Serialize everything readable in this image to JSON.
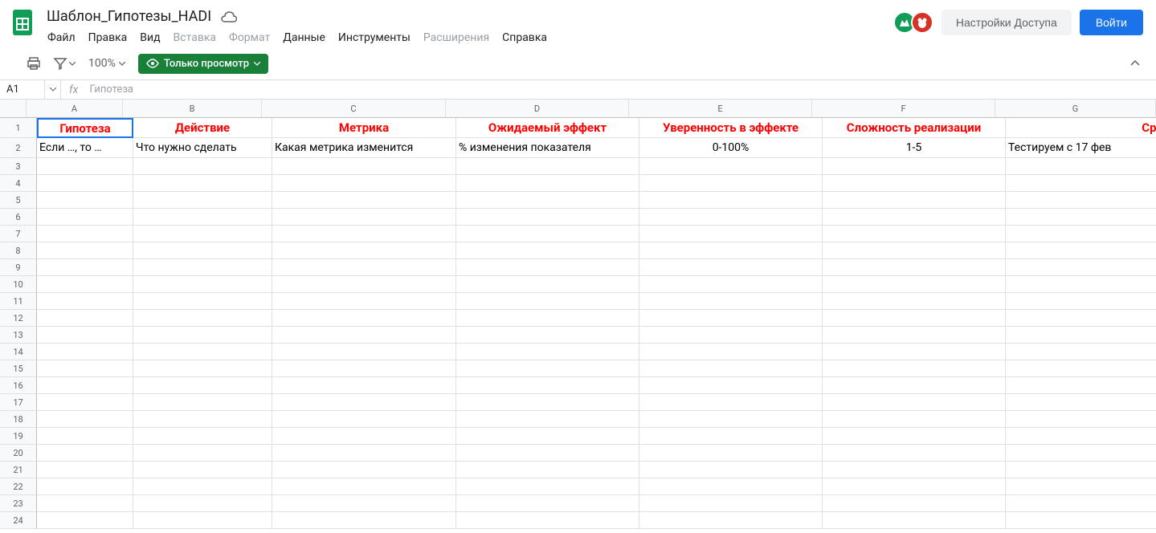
{
  "doc": {
    "title": "Шаблон_Гипотезы_HADI"
  },
  "menu": {
    "file": "Файл",
    "edit": "Правка",
    "view": "Вид",
    "insert": "Вставка",
    "format": "Формат",
    "data": "Данные",
    "tools": "Инструменты",
    "extensions": "Расширения",
    "help": "Справка"
  },
  "header": {
    "share": "Настройки Доступа",
    "login": "Войти"
  },
  "toolbar": {
    "zoom": "100%",
    "view_only": "Только просмотр"
  },
  "formula": {
    "cell_ref": "A1",
    "content": "Гипотеза"
  },
  "columns": [
    "A",
    "B",
    "C",
    "D",
    "E",
    "F",
    "G"
  ],
  "row_numbers": [
    "1",
    "2",
    "3",
    "4",
    "5",
    "6",
    "7",
    "8",
    "9",
    "10",
    "11",
    "12",
    "13",
    "14",
    "15",
    "16",
    "17",
    "18",
    "19",
    "20",
    "21",
    "22",
    "23",
    "24"
  ],
  "sheet": {
    "headers": {
      "a": "Гипотеза",
      "b": "Действие",
      "c": "Метрика",
      "d": "Ожидаемый эффект",
      "e": "Уверенность в эффекте",
      "f": "Сложность реализации",
      "g": "Сро"
    },
    "row2": {
      "a": "Если …, то …",
      "b": "Что нужно сделать",
      "c": "Какая метрика изменится",
      "d": "% изменения показателя",
      "e": "0-100%",
      "f": "1-5",
      "g": "Тестируем с 17 фев"
    }
  }
}
